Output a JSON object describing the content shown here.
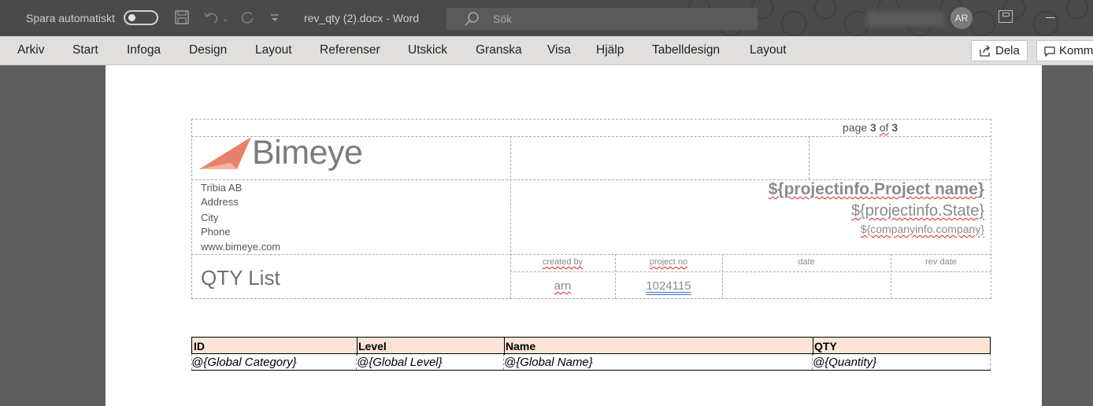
{
  "titlebar": {
    "autosave_label": "Spara automatiskt",
    "doc_title": "rev_qty (2).docx  -  Word",
    "search_placeholder": "Sök",
    "user_initials": "AR"
  },
  "menu": {
    "items": [
      "Arkiv",
      "Start",
      "Infoga",
      "Design",
      "Layout",
      "Referenser",
      "Utskick",
      "Granska",
      "Visa",
      "Hjälp",
      "Tabelldesign",
      "Layout"
    ],
    "share_label": "Dela",
    "comments_label": "Kommentarer"
  },
  "document": {
    "page_number": {
      "prefix": "page ",
      "current": "3",
      "of": "of",
      "total": "3"
    },
    "brand": "Bimeye",
    "brand_color": "#e8806a",
    "address_lines": [
      "Tribia AB",
      "Address",
      "City",
      "Phone",
      "www.bimeye.com"
    ],
    "template_project_name": "${projectinfo.Project name}",
    "template_project_state": "${projectinfo.State}",
    "template_company": "${companyinfo.company}",
    "doc_heading": "QTY List",
    "meta_labels": {
      "created_by": "created by",
      "project_no": "project no",
      "date": "date",
      "rev_date": "rev date"
    },
    "meta_values": {
      "created_by": "arn",
      "project_no": "1024115",
      "date": "",
      "rev_date": ""
    },
    "table": {
      "header_color": "#fbe4d6",
      "headers": [
        "ID",
        "Level",
        "Name",
        "QTY"
      ],
      "row": [
        "@{Global Category}",
        "@{Global Level}",
        "@{Global Name}",
        "@{Quantity}"
      ]
    }
  }
}
